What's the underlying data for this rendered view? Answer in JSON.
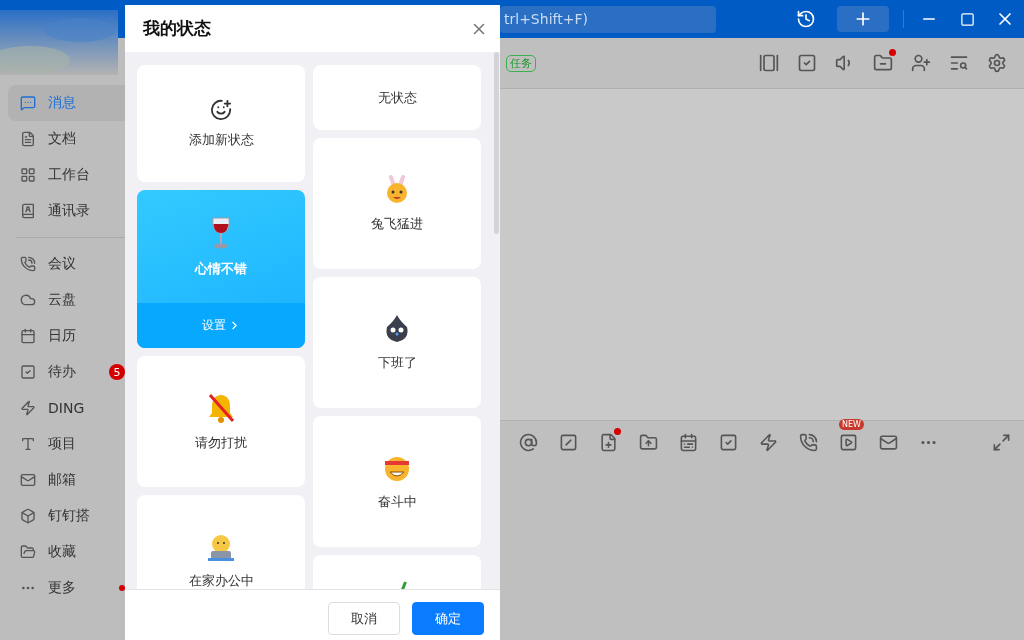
{
  "title_bar": {
    "search": {
      "placeholder": "trl+Shift+F)"
    }
  },
  "sidebar": {
    "items": [
      {
        "label": "消息",
        "selected": true,
        "dot": false
      },
      {
        "label": "文档",
        "selected": false,
        "dot": false
      },
      {
        "label": "工作台",
        "selected": false,
        "dot": false
      },
      {
        "label": "通讯录",
        "selected": false,
        "dot": false
      },
      {
        "label": "会议",
        "selected": false,
        "dot": false
      },
      {
        "label": "云盘",
        "selected": false,
        "dot": false
      },
      {
        "label": "日历",
        "selected": false,
        "dot": false
      },
      {
        "label": "待办",
        "selected": false,
        "dot": false,
        "badge": "5"
      },
      {
        "label": "DING",
        "selected": false,
        "dot": false
      },
      {
        "label": "项目",
        "selected": false,
        "dot": false
      },
      {
        "label": "邮箱",
        "selected": false,
        "dot": false
      },
      {
        "label": "钉钉搭",
        "selected": false,
        "dot": false
      },
      {
        "label": "收藏",
        "selected": false,
        "dot": false
      },
      {
        "label": "更多",
        "selected": false,
        "dot": true
      }
    ]
  },
  "chat": {
    "tag": "任务",
    "header_tools": [
      {
        "dot": false
      },
      {
        "dot": false
      },
      {
        "dot": false
      },
      {
        "dot": true
      },
      {
        "dot": false
      },
      {
        "dot": false
      },
      {
        "dot": false
      }
    ],
    "input_tools": [
      {
        "dot": false
      },
      {
        "dot": false
      },
      {
        "dot": true
      },
      {
        "dot": false
      },
      {
        "dot": false
      },
      {
        "dot": false
      },
      {
        "dot": false
      },
      {
        "dot": false
      },
      {
        "dot": false,
        "badge": "NEW"
      },
      {
        "dot": false
      },
      {
        "dot": false
      },
      {
        "dot": false
      }
    ]
  },
  "dialog": {
    "title": "我的状态",
    "columns": [
      [
        {
          "kind": "add",
          "label": "添加新状态",
          "selected": false
        },
        {
          "kind": "status",
          "label": "心情不错",
          "selected": true,
          "action": "设置"
        },
        {
          "kind": "status",
          "label": "请勿打扰",
          "selected": false
        },
        {
          "kind": "status",
          "label": "在家办公中",
          "selected": false
        }
      ],
      [
        {
          "kind": "none",
          "label": "无状态",
          "selected": false
        },
        {
          "kind": "status",
          "label": "兔飞猛进",
          "selected": false
        },
        {
          "kind": "status",
          "label": "下班了",
          "selected": false
        },
        {
          "kind": "status",
          "label": "奋斗中",
          "selected": false
        },
        {
          "kind": "status",
          "selected": false
        }
      ]
    ],
    "buttons": [
      {
        "label": "取消",
        "kind": "secondary"
      },
      {
        "label": "确定",
        "kind": "primary"
      }
    ]
  }
}
